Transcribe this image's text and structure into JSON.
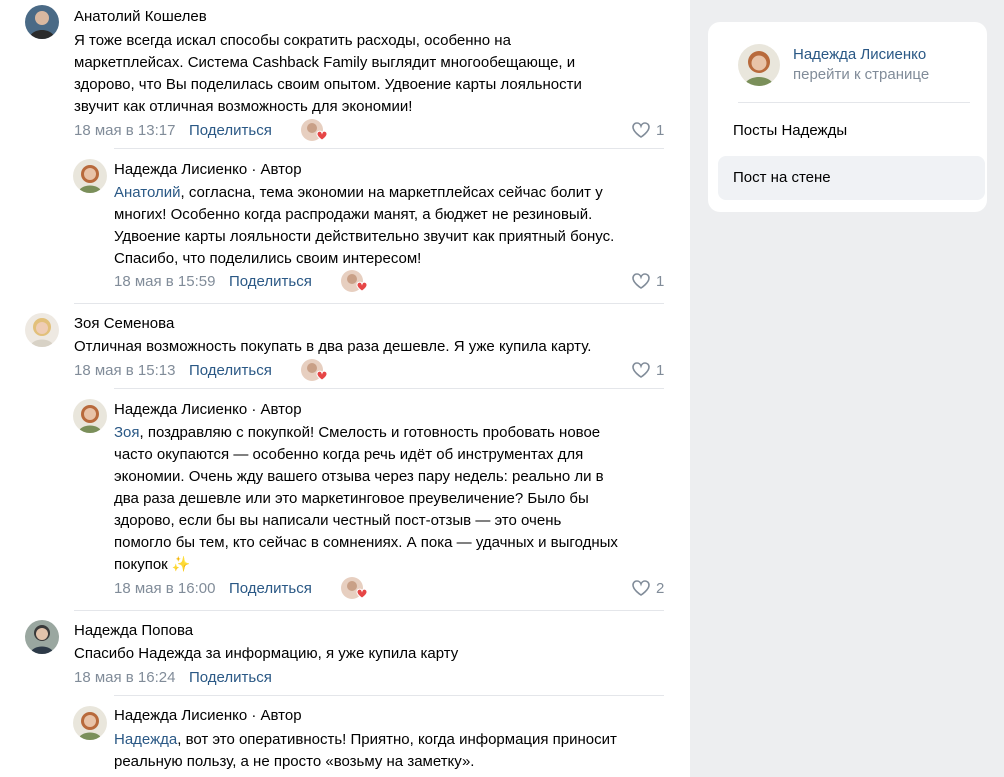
{
  "comments": [
    {
      "author": "Анатолий Кошелев",
      "lines": [
        "Я тоже всегда искал способы сократить расходы, особенно на",
        "маркетплейсах. Система Cashback Family выглядит многообещающе, и",
        "здорово, что Вы поделилась своим опытом. Удвоение карты лояльности",
        "звучит как отличная возможность для экономии!"
      ],
      "time": "18 мая в 13:17",
      "share": "Поделиться",
      "likes": "1"
    },
    {
      "author": "Надежда Лисиенко · Автор",
      "mention": "Анатолий",
      "lines": [
        ", согласна, тема экономии на маркетплейсах сейчас болит у",
        "многих! Особенно когда распродажи манят, а бюджет не резиновый.",
        "Удвоение карты лояльности действительно звучит как приятный бонус.",
        "Спасибо, что поделились своим интересом!"
      ],
      "time": "18 мая в 15:59",
      "share": "Поделиться",
      "likes": "1"
    },
    {
      "author": "Зоя Семенова",
      "lines": [
        "Отличная возможность покупать в два раза дешевле. Я уже купила карту."
      ],
      "time": "18 мая в 15:13",
      "share": "Поделиться",
      "likes": "1"
    },
    {
      "author": "Надежда Лисиенко · Автор",
      "mention": "Зоя",
      "lines": [
        ", поздравляю с покупкой! Смелость и готовность пробовать новое",
        "часто окупаются — особенно когда речь идёт об инструментах для",
        "экономии. Очень жду вашего отзыва через пару недель: реально ли в",
        "два раза дешевле или это маркетинговое преувеличение? Было бы",
        "здорово, если бы вы написали честный пост-отзыв — это очень",
        "помогло бы тем, кто сейчас в сомнениях. А пока — удачных и выгодных",
        "покупок ✨"
      ],
      "time": "18 мая в 16:00",
      "share": "Поделиться",
      "likes": "2"
    },
    {
      "author": "Надежда Попова",
      "lines": [
        "Спасибо Надежда за информацию, я уже купила карту"
      ],
      "time": "18 мая в 16:24",
      "share": "Поделиться"
    },
    {
      "author": "Надежда Лисиенко · Автор",
      "mention": "Надежда",
      "lines": [
        ", вот это оперативность! Приятно, когда информация приносит",
        "реальную пользу, а не просто «возьму на заметку»."
      ]
    }
  ],
  "sidebar": {
    "profile_name": "Надежда Лисиенко",
    "profile_link": "перейти к странице",
    "menu": [
      "Посты Надежды",
      "Пост на стене"
    ]
  },
  "colors": {
    "link": "#2a5885",
    "muted": "#818c99",
    "like_heart": "#e64646"
  }
}
